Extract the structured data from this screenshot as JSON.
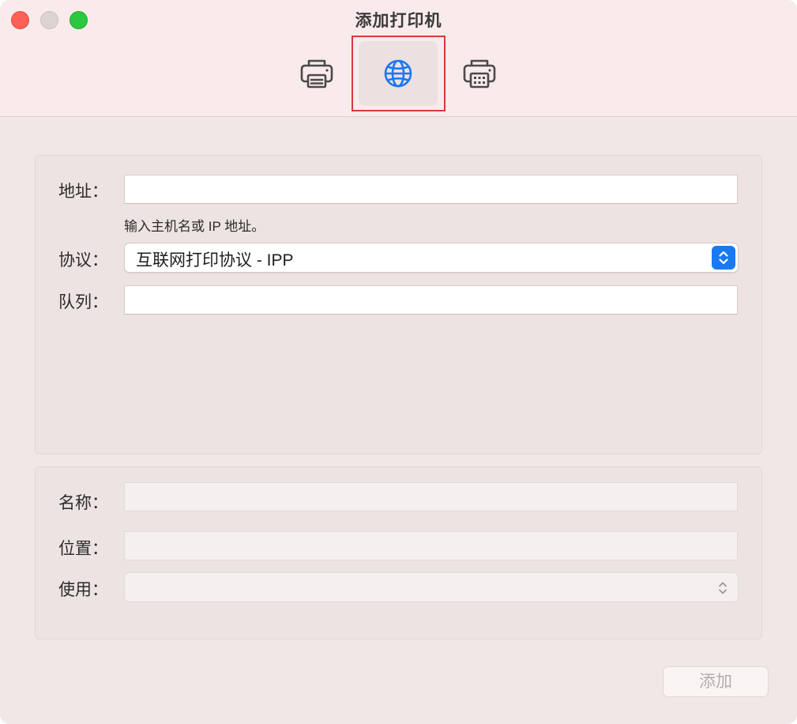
{
  "window": {
    "title": "添加打印机"
  },
  "toolbar": {
    "items": [
      {
        "icon": "printer-icon",
        "selected": false
      },
      {
        "icon": "globe-icon",
        "selected": true
      },
      {
        "icon": "windows-printer-icon",
        "selected": false
      }
    ],
    "accent_color": "#1a78f2"
  },
  "form": {
    "address": {
      "label": "地址：",
      "value": "",
      "hint": "输入主机名或 IP 地址。"
    },
    "protocol": {
      "label": "协议：",
      "value": "互联网打印协议 - IPP"
    },
    "queue": {
      "label": "队列：",
      "value": ""
    }
  },
  "details": {
    "name": {
      "label": "名称：",
      "value": ""
    },
    "location": {
      "label": "位置：",
      "value": ""
    },
    "use": {
      "label": "使用：",
      "value": ""
    }
  },
  "actions": {
    "add_label": "添加"
  }
}
